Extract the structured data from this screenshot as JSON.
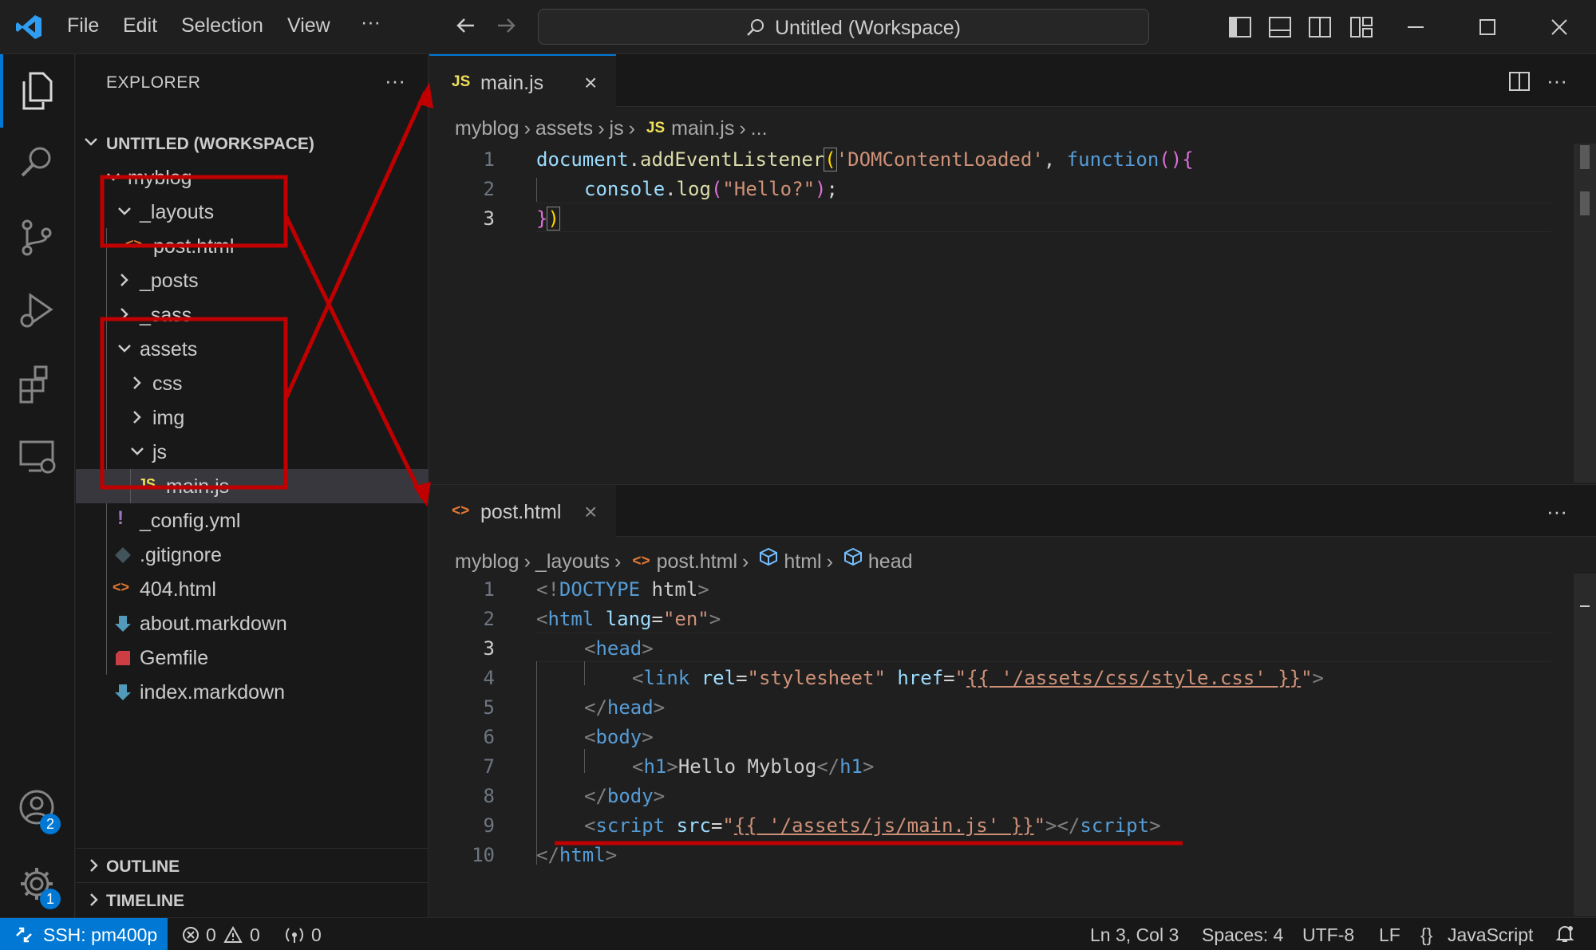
{
  "titlebar": {
    "menu": [
      "File",
      "Edit",
      "Selection",
      "View",
      "···"
    ],
    "search_text": "Untitled (Workspace)"
  },
  "activitybar": {
    "accounts_badge": "2",
    "settings_badge": "1"
  },
  "sidebar": {
    "title": "EXPLORER",
    "more": "···",
    "workspace": "UNTITLED (WORKSPACE)",
    "tree": [
      {
        "label": "myblog",
        "type": "folder",
        "open": true
      },
      {
        "label": "_layouts",
        "type": "folder",
        "open": true
      },
      {
        "label": "post.html",
        "type": "html"
      },
      {
        "label": "_posts",
        "type": "folder",
        "open": false
      },
      {
        "label": "_sass",
        "type": "folder",
        "open": false
      },
      {
        "label": "assets",
        "type": "folder",
        "open": true
      },
      {
        "label": "css",
        "type": "folder",
        "open": false
      },
      {
        "label": "img",
        "type": "folder",
        "open": false
      },
      {
        "label": "js",
        "type": "folder",
        "open": true
      },
      {
        "label": "main.js",
        "type": "js",
        "selected": true
      },
      {
        "label": "_config.yml",
        "type": "yml"
      },
      {
        "label": ".gitignore",
        "type": "git"
      },
      {
        "label": "404.html",
        "type": "html"
      },
      {
        "label": "about.markdown",
        "type": "md"
      },
      {
        "label": "Gemfile",
        "type": "ruby"
      },
      {
        "label": "index.markdown",
        "type": "md"
      }
    ],
    "outline": "OUTLINE",
    "timeline": "TIMELINE"
  },
  "editor_top": {
    "tab_icon": "JS",
    "tab_label": "main.js",
    "close": "×",
    "breadcrumb": [
      "myblog",
      "assets",
      "js",
      "main.js",
      "..."
    ],
    "line_numbers": [
      "1",
      "2",
      "3"
    ]
  },
  "editor_bottom": {
    "tab_icon": "<>",
    "tab_label": "post.html",
    "close": "×",
    "more": "···",
    "breadcrumb": [
      "myblog",
      "_layouts",
      "post.html",
      "html",
      "head"
    ],
    "line_numbers": [
      "1",
      "2",
      "3",
      "4",
      "5",
      "6",
      "7",
      "8",
      "9",
      "10"
    ]
  },
  "statusbar": {
    "remote": "SSH: pm400p",
    "errors": "0",
    "warnings": "0",
    "ports": "0",
    "position": "Ln 3, Col 3",
    "spaces": "Spaces: 4",
    "encoding": "UTF-8",
    "eol": "LF",
    "language": "JavaScript"
  },
  "colors": {
    "accent": "#0078d4",
    "annotation": "#c00000",
    "js_icon": "#f1e05a",
    "html_icon": "#e37933"
  }
}
